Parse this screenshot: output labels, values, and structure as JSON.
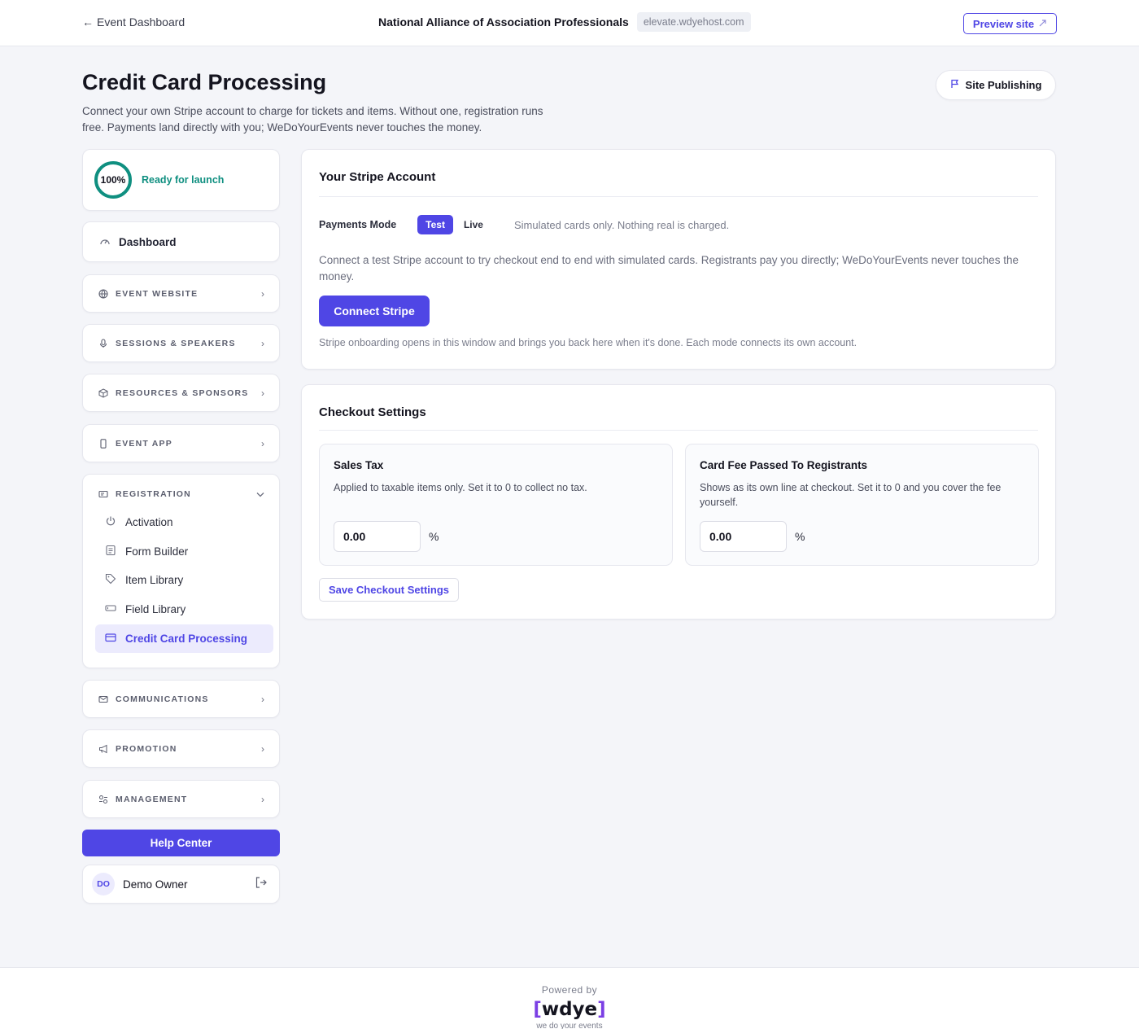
{
  "topbar": {
    "back_label": "Event Dashboard",
    "org_name": "National Alliance of Association Professionals",
    "domain": "elevate.wdyehost.com",
    "preview_label": "Preview site"
  },
  "header": {
    "title": "Credit Card Processing",
    "description": "Connect your own Stripe account to charge for tickets and items. Without one, registration runs free. Payments land directly with you; WeDoYourEvents never touches the money.",
    "publish_label": "Site Publishing"
  },
  "sidebar": {
    "progress": {
      "percent_label": "100%",
      "percent": 100,
      "status": "Ready for launch"
    },
    "dashboard_label": "Dashboard",
    "sections": [
      {
        "label": "EVENT WEBSITE",
        "icon": "globe-icon"
      },
      {
        "label": "SESSIONS & SPEAKERS",
        "icon": "microphone-icon"
      },
      {
        "label": "RESOURCES & SPONSORS",
        "icon": "box-icon"
      },
      {
        "label": "EVENT APP",
        "icon": "phone-icon"
      }
    ],
    "registration": {
      "label": "REGISTRATION",
      "items": [
        {
          "label": "Activation",
          "icon": "power-icon"
        },
        {
          "label": "Form Builder",
          "icon": "form-icon"
        },
        {
          "label": "Item Library",
          "icon": "tag-icon"
        },
        {
          "label": "Field Library",
          "icon": "field-icon"
        },
        {
          "label": "Credit Card Processing",
          "icon": "credit-card-icon",
          "active": true
        }
      ]
    },
    "sections_after": [
      {
        "label": "COMMUNICATIONS",
        "icon": "mail-icon"
      },
      {
        "label": "PROMOTION",
        "icon": "megaphone-icon"
      },
      {
        "label": "MANAGEMENT",
        "icon": "settings-icon"
      }
    ],
    "help_label": "Help Center",
    "user": {
      "initials": "DO",
      "name": "Demo Owner"
    }
  },
  "stripe": {
    "title": "Your Stripe Account",
    "mode_label": "Payments Mode",
    "mode_test": "Test",
    "mode_live": "Live",
    "mode_note": "Simulated cards only. Nothing real is charged.",
    "description": "Connect a test Stripe account to try checkout end to end with simulated cards. Registrants pay you directly; WeDoYourEvents never touches the money.",
    "connect_label": "Connect Stripe",
    "note": "Stripe onboarding opens in this window and brings you back here when it's done. Each mode connects its own account."
  },
  "checkout": {
    "title": "Checkout Settings",
    "sales_tax": {
      "title": "Sales Tax",
      "description": "Applied to taxable items only. Set it to 0 to collect no tax.",
      "value": "0.00",
      "unit": "%"
    },
    "card_fee": {
      "title": "Card Fee Passed To Registrants",
      "description": "Shows as its own line at checkout. Set it to 0 and you cover the fee yourself.",
      "value": "0.00",
      "unit": "%"
    },
    "save_label": "Save Checkout Settings"
  },
  "footer": {
    "powered_by": "Powered by",
    "logo_open": "[",
    "logo_text": "wdye",
    "logo_close": "]",
    "tagline": "we do your events"
  },
  "colors": {
    "accent": "#4f46e5",
    "success": "#0f8f80",
    "logo_bracket": "#7b3fe4"
  }
}
